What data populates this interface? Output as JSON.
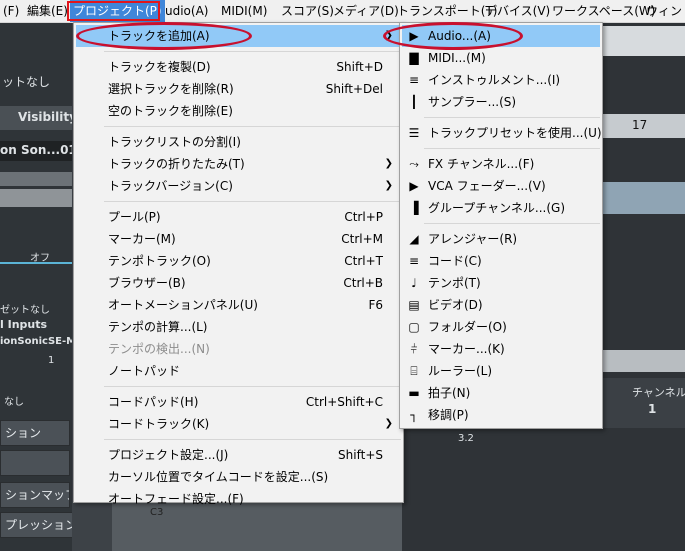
{
  "menubar": {
    "items": [
      "(F)",
      "編集(E)",
      "プロジェクト(P)",
      "udio(A)",
      "MIDI(M)",
      "スコア(S)",
      "メディア(D)",
      "トランスポート(T)",
      "デバイス(V)",
      "ワークスペース(W)",
      "ウィンドウ"
    ]
  },
  "background": {
    "left_no_label": "ットなし",
    "visibility_tab": "Visibility",
    "track_name": "on Son...01",
    "off_label": "オフ",
    "preset_none": "ゼットなし",
    "inputs_label": "l Inputs",
    "instrument_label": "ionSonicSE-MI",
    "channel_number": "1",
    "none_label": "なし",
    "btn_1": "ション",
    "btn_3": "ションマップ",
    "btn_4": "プレッション",
    "ruler_17": "17",
    "channel_header": "チャンネル",
    "channel_value": "1",
    "ruler_32": "3.2",
    "note_c3": "C3"
  },
  "project_menu": {
    "groups": [
      [
        {
          "label": "トラックを追加(A)",
          "shortcut": "",
          "submenu": true,
          "state": "hover"
        }
      ],
      [
        {
          "label": "トラックを複製(D)",
          "shortcut": "Shift+D"
        },
        {
          "label": "選択トラックを削除(R)",
          "shortcut": "Shift+Del"
        },
        {
          "label": "空のトラックを削除(E)",
          "shortcut": ""
        }
      ],
      [
        {
          "label": "トラックリストの分割(I)",
          "shortcut": ""
        },
        {
          "label": "トラックの折りたたみ(T)",
          "shortcut": "",
          "submenu": true
        },
        {
          "label": "トラックバージョン(C)",
          "shortcut": "",
          "submenu": true
        }
      ],
      [
        {
          "label": "プール(P)",
          "shortcut": "Ctrl+P"
        },
        {
          "label": "マーカー(M)",
          "shortcut": "Ctrl+M"
        },
        {
          "label": "テンポトラック(O)",
          "shortcut": "Ctrl+T"
        },
        {
          "label": "ブラウザー(B)",
          "shortcut": "Ctrl+B"
        },
        {
          "label": "オートメーションパネル(U)",
          "shortcut": "F6"
        },
        {
          "label": "テンポの計算...(L)",
          "shortcut": ""
        },
        {
          "label": "テンポの検出...(N)",
          "shortcut": "",
          "state": "disabled"
        },
        {
          "label": "ノートパッド",
          "shortcut": ""
        }
      ],
      [
        {
          "label": "コードパッド(H)",
          "shortcut": "Ctrl+Shift+C"
        },
        {
          "label": "コードトラック(K)",
          "shortcut": "",
          "submenu": true
        }
      ],
      [
        {
          "label": "プロジェクト設定...(J)",
          "shortcut": "Shift+S"
        },
        {
          "label": "カーソル位置でタイムコードを設定...(S)",
          "shortcut": ""
        },
        {
          "label": "オートフェード設定...(F)",
          "shortcut": ""
        }
      ]
    ]
  },
  "add_track_submenu": {
    "groups": [
      [
        {
          "label": "Audio...(A)",
          "icon": "play-triangle-icon",
          "state": "hover"
        },
        {
          "label": "MIDI...(M)",
          "icon": "midi-keys-icon"
        },
        {
          "label": "インストゥルメント...(I)",
          "icon": "instrument-icon"
        },
        {
          "label": "サンプラー...(S)",
          "icon": "sampler-waveform-icon"
        }
      ],
      [
        {
          "label": "トラックプリセットを使用...(U)",
          "icon": "track-preset-icon"
        }
      ],
      [
        {
          "label": "FX チャンネル...(F)",
          "icon": "fx-channel-icon"
        },
        {
          "label": "VCA フェーダー...(V)",
          "icon": "vca-fader-icon"
        },
        {
          "label": "グループチャンネル...(G)",
          "icon": "group-channel-icon"
        }
      ],
      [
        {
          "label": "アレンジャー(R)",
          "icon": "arranger-icon"
        },
        {
          "label": "コード(C)",
          "icon": "chord-icon"
        },
        {
          "label": "テンポ(T)",
          "icon": "tempo-icon"
        },
        {
          "label": "ビデオ(D)",
          "icon": "video-icon"
        },
        {
          "label": "フォルダー(O)",
          "icon": "folder-icon"
        },
        {
          "label": "マーカー...(K)",
          "icon": "marker-icon"
        },
        {
          "label": "ルーラー(L)",
          "icon": "ruler-icon"
        },
        {
          "label": "拍子(N)",
          "icon": "signature-icon"
        },
        {
          "label": "移調(P)",
          "icon": "transpose-icon"
        }
      ]
    ]
  },
  "colors": {
    "menu_hover": "#91c9f7",
    "menubar_active": "#3f86d9",
    "annotation_red": "#c8102e"
  }
}
